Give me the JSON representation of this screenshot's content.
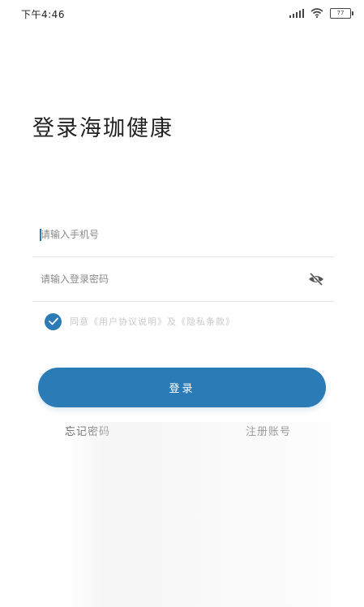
{
  "status_bar": {
    "time": "下午4:46",
    "battery": "77"
  },
  "title": "登录海珈健康",
  "phone_field": {
    "placeholder": "请输入手机号",
    "value": ""
  },
  "password_field": {
    "placeholder": "请输入登录密码",
    "value": ""
  },
  "agreement": {
    "checked": true,
    "text": "同意《用户协议说明》及《隐私条款》"
  },
  "login_button": {
    "label": "登录"
  },
  "links": {
    "forgot_password": "忘记密码",
    "register": "注册账号"
  },
  "colors": {
    "accent": "#2b7cb6",
    "divider": "#e6e6e6",
    "placeholder": "#8a8a8a"
  },
  "icons": {
    "signal": "signal-icon",
    "wifi": "wifi-icon",
    "battery": "battery-icon",
    "password_visibility": "eye-off-icon",
    "checkbox": "check-icon"
  }
}
